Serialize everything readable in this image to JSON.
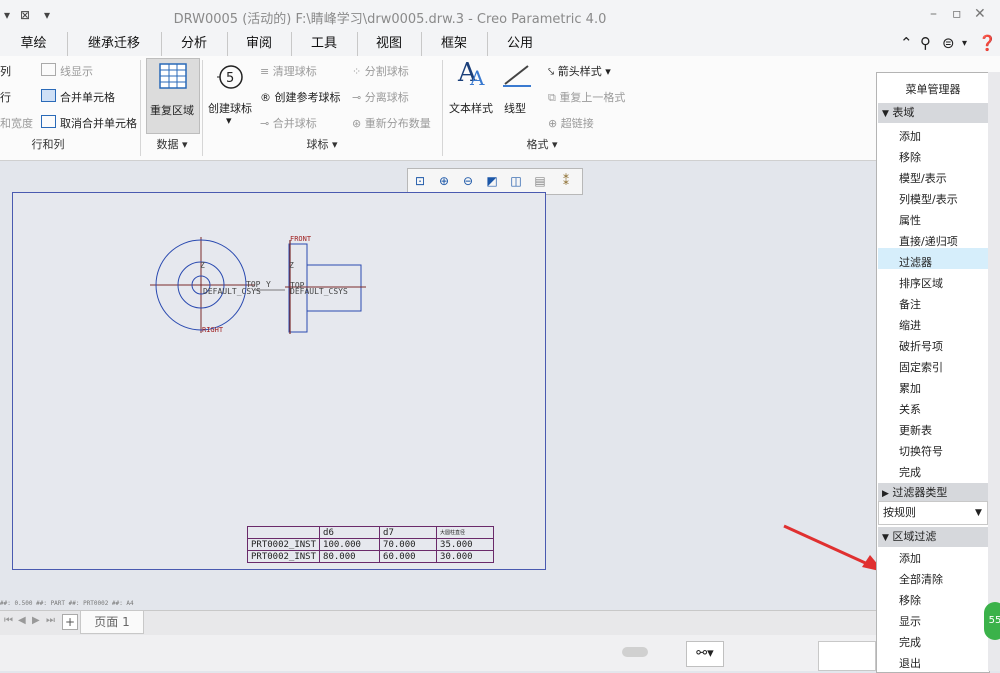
{
  "window": {
    "title": "DRW0005 (活动的) F:\\睛峰学习\\drw0005.drw.3 - Creo Parametric 4.0"
  },
  "tabs": [
    "草绘",
    "继承迁移",
    "分析",
    "审阅",
    "工具",
    "视图",
    "框架",
    "公用"
  ],
  "ribbon": {
    "rows_cols": {
      "items": [
        "列",
        "行",
        "和宽度"
      ],
      "line_display": "线显示",
      "merge_cells": "合并单元格",
      "unmerge_cells": "取消合并单元格",
      "group": "行和列"
    },
    "data": {
      "repeat_region": "重复区域",
      "group": "数据"
    },
    "balloons": {
      "create": "创建球标",
      "clear": "清理球标",
      "create_ref": "创建参考球标",
      "merge": "合并球标",
      "split": "分割球标",
      "separate": "分离球标",
      "redistribute": "重新分布数量",
      "group": "球标"
    },
    "format": {
      "text_style": "文本样式",
      "line_style": "线型",
      "arrow_style": "箭头样式",
      "repeat_format": "重复上一格式",
      "hyperlink": "超链接",
      "group": "格式"
    }
  },
  "drawing": {
    "front": "FRONT",
    "top1": "TOP",
    "top2": "TOP",
    "csys1": "DEFAULT_CSYS",
    "csys2": "DEFAULT_CSYS",
    "right": "RIGHT",
    "z1": "Z",
    "z2": "Z",
    "y1": "Y"
  },
  "table": {
    "headers": [
      "",
      "d6",
      "d7",
      "大圆柱直径"
    ],
    "rows": [
      [
        "PRT0002_INST",
        "100.000",
        "70.000",
        "35.000"
      ],
      [
        "PRT0002_INST",
        "80.000",
        "60.000",
        "30.000"
      ]
    ]
  },
  "status": "##: 0.500  ##: PART  ##: PRT0002  ##: A4",
  "page_tab": "页面 1",
  "menu_manager": {
    "title": "菜单管理器",
    "section1": "表域",
    "items1": [
      "添加",
      "移除",
      "模型/表示",
      "列模型/表示",
      "属性",
      "直接/递归项",
      "过滤器",
      "排序区域",
      "备注",
      "缩进",
      "破折号项",
      "固定索引",
      "累加",
      "关系",
      "更新表",
      "切换符号",
      "完成"
    ],
    "section2": "过滤器类型",
    "select_value": "按规则",
    "section3": "区域过滤",
    "items3": [
      "添加",
      "全部清除",
      "移除",
      "显示",
      "完成",
      "退出"
    ]
  },
  "badge": "55",
  "colors": {
    "selected_item": "#d6eefb",
    "sheet_border": "#4a5ab0",
    "table_border": "#6a2a6a",
    "arrow": "#e03030"
  }
}
